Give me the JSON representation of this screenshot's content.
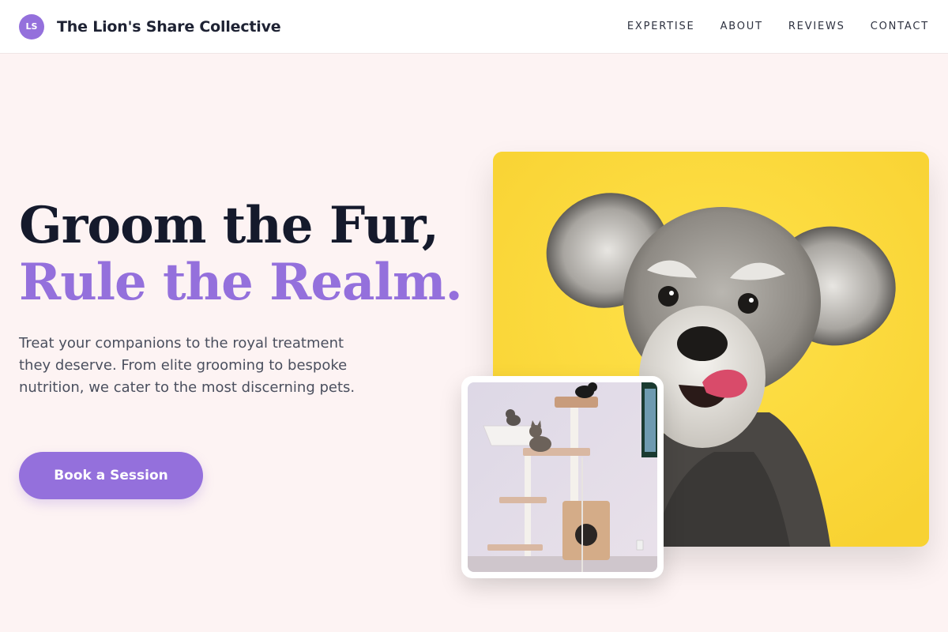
{
  "brand": {
    "logo_initials": "LS",
    "name": "The Lion's Share Collective"
  },
  "nav": {
    "items": [
      {
        "label": "EXPERTISE"
      },
      {
        "label": "ABOUT"
      },
      {
        "label": "REVIEWS"
      },
      {
        "label": "CONTACT"
      }
    ]
  },
  "hero": {
    "title_line1": "Groom the Fur,",
    "title_line2": "Rule the Realm.",
    "description": "Treat your companions to the royal treatment they deserve. From elite grooming to bespoke nutrition, we cater to the most discerning pets.",
    "cta_label": "Book a Session"
  },
  "images": {
    "main": "schnauzer-dog-yellow-background",
    "secondary": "cats-on-cat-tree"
  },
  "colors": {
    "accent": "#9470dc",
    "heading": "#151a2c",
    "background": "#fdf3f3",
    "dog_backdrop": "#fcd937"
  }
}
